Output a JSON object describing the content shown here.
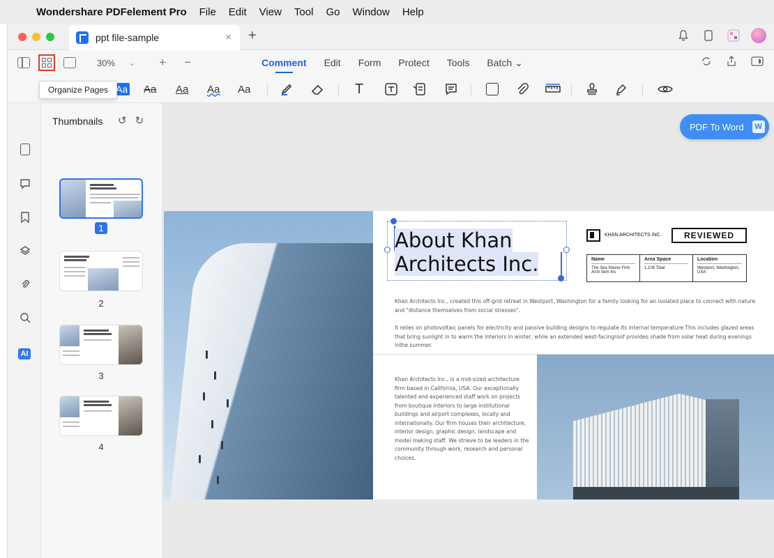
{
  "menubar": {
    "app_name": "Wondershare PDFelement Pro",
    "menus": [
      "File",
      "Edit",
      "View",
      "Tool",
      "Go",
      "Window",
      "Help"
    ]
  },
  "tab": {
    "title": "ppt file-sample",
    "close": "×",
    "new": "+"
  },
  "toolbar": {
    "zoom": "30%",
    "zoom_plus": "+",
    "zoom_minus": "−",
    "tabs": [
      "Comment",
      "Edit",
      "Form",
      "Protect",
      "Tools",
      "Batch ⌄"
    ],
    "active_tab": "Comment",
    "tooltip": "Organize Pages",
    "accent": "#1e61e0",
    "comment_tools": {
      "highlight": "Aa",
      "strikethrough": "Aa",
      "underline": "Aa",
      "squiggly": "Aa",
      "insert": "Aa",
      "text": "T"
    }
  },
  "thumbnails": {
    "title": "Thumbnails",
    "pages": [
      "1",
      "2",
      "3",
      "4"
    ],
    "selected": "1"
  },
  "cta": {
    "label": "PDF To Word",
    "badge": "W",
    "color": "#3e8ef5"
  },
  "document": {
    "title_line1": "About Khan",
    "title_line2": "Architects Inc.",
    "logo_text": "KHAN ARCHITECTS INC.",
    "reviewed": "REVIEWED",
    "table": {
      "headers": [
        "Name",
        "Area Space",
        "Location"
      ],
      "values": [
        "The Sea House Firm Arch Item Inc",
        "1,108 Total",
        "Westport, Washington, USA"
      ]
    },
    "para1": "Khan Architects Inc., created this off-grid retreat in Westport, Washington for a family looking for an isolated place to connect with nature and \"distance themselves from social stresses\".",
    "para2": "It relies on photovoltaic panels for electricity and passive building designs to regulate its internal temperature.This includes glazed areas that bring sunlight in to warm the interiors in winter, while an extended west-facingroof provides shade from solar heat during evenings inthe summer.",
    "para3": "Khan Architects Inc., is a mid-sized architecture firm based in California, USA. Our exceptionally talented and experienced staff work on projects from boutique interiors to large institutional buildings and airport complexes, locally and internationally. Our firm houses their architecture, interior design, graphic design, landscape and model making staff. We strieve to be leaders in the community through work, research and personal choices."
  }
}
